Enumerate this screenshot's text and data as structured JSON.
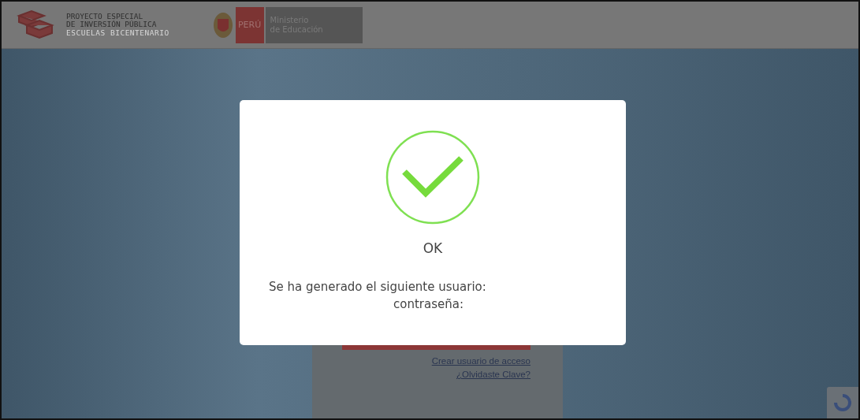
{
  "header": {
    "project_lines": [
      "PROYECTO ESPECIAL",
      "DE INVERSIÓN PÚBLICA",
      "ESCUELAS BICENTENARIO"
    ],
    "country": "PERÚ",
    "ministry_lines": [
      "Ministerio",
      "de Educación"
    ]
  },
  "login": {
    "links": [
      "Crear usuario de acceso",
      "¿Olvidaste Clave?"
    ]
  },
  "modal": {
    "title": "OK",
    "message_lines": [
      "Se ha generado el siguiente usuario:",
      "contraseña:"
    ]
  }
}
